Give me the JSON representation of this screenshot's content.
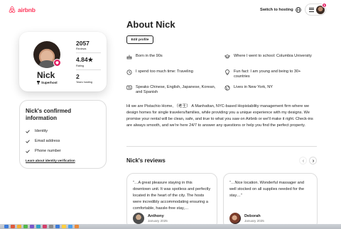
{
  "header": {
    "logo_text": "airbnb",
    "switch_label": "Switch to hosting",
    "notification_count": "1"
  },
  "profile": {
    "name": "Nick",
    "superhost_label": "Superhost",
    "stats": [
      {
        "value": "2057",
        "label": "Reviews"
      },
      {
        "value": "4.84★",
        "label": "Rating"
      },
      {
        "value": "2",
        "label": "Years hosting"
      }
    ]
  },
  "confirmed": {
    "title": "Nick's confirmed information",
    "items": [
      "Identity",
      "Email address",
      "Phone number"
    ],
    "link": "Learn about identity verification"
  },
  "about": {
    "title": "About Nick",
    "edit_label": "Edit profile",
    "facts": [
      {
        "icon": "cake-icon",
        "text": "Born in the 90s"
      },
      {
        "icon": "school-icon",
        "text": "Where I went to school: Columbia University"
      },
      {
        "icon": "clock-icon",
        "text": "I spend too much time: Traveling"
      },
      {
        "icon": "lightbulb-icon",
        "text": "Fun fact: I am young and being to 30+ countries"
      },
      {
        "icon": "language-icon",
        "text": "Speaks Chinese, English, Japanese, Korean, and Spanish"
      },
      {
        "icon": "globe-icon",
        "text": "Lives in New York, NY"
      }
    ],
    "bio": "Hi we are Pistachio Home, （老王） A Manhattan, NYC-based Hopistability management firm where we design homes for single travelers/families, while providing you a unique experience with my designs. We promise your rental will be clean, safe, and true to what you saw on Airbnb or we'll make it right. Check-ins are always smooth, and we're here 24/7 to answer any questions or help you find the perfect property."
  },
  "reviews": {
    "title": "Nick's reviews",
    "items": [
      {
        "text": "“…A great pleasure staying in this downtown unit. It was spotless and perfectly located in the heart of the city. The hosts were incredibly accommodating ensuring a comfortable, hassle-free stay,…",
        "name": "Anthony",
        "date": "January 2025"
      },
      {
        "text": "“…Nice location. Wonderful massager and well stocked on all supplies needed for the stay…”",
        "name": "Deborah",
        "date": "January 2025"
      }
    ]
  },
  "colors": {
    "brand": "#FF385C",
    "badge": "#E31C5F",
    "border": "#DDDDDD",
    "text": "#222222"
  }
}
